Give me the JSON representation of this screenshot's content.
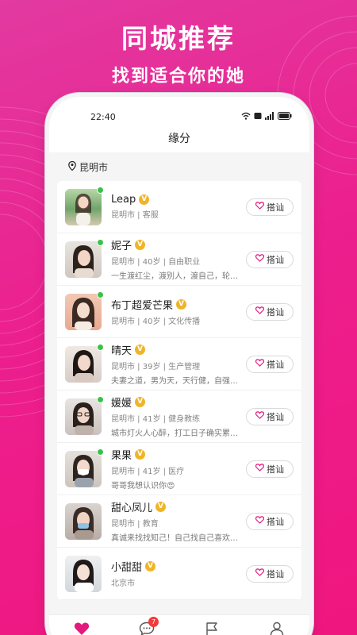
{
  "promo": {
    "headline": "同城推荐",
    "subline": "找到适合你的她"
  },
  "status_bar": {
    "time": "22:40"
  },
  "nav": {
    "title": "缘分"
  },
  "location": {
    "city": "昆明市"
  },
  "users": [
    {
      "name": "Leap",
      "meta": "昆明市 | 客服",
      "bio": "",
      "online": true,
      "greet": "搭讪"
    },
    {
      "name": "妮子",
      "meta": "昆明市 | 40岁 | 自由职业",
      "bio": "一生渡红尘，渡别人，渡自己，轮…",
      "online": true,
      "greet": "搭讪"
    },
    {
      "name": "布丁超爱芒果",
      "meta": "昆明市 | 40岁 | 文化传播",
      "bio": "",
      "online": true,
      "greet": "搭讪"
    },
    {
      "name": "晴天",
      "meta": "昆明市 | 39岁 | 生产管理",
      "bio": "夫妻之道，男为天，天行健，自强…",
      "online": true,
      "greet": "搭讪"
    },
    {
      "name": "媛媛",
      "meta": "昆明市 | 41岁 | 健身教练",
      "bio": "城市灯火人心醉，打工日子确实累…",
      "online": true,
      "greet": "搭讪"
    },
    {
      "name": "果果",
      "meta": "昆明市 | 41岁 | 医疗",
      "bio": "哥哥我想认识你😍",
      "online": true,
      "greet": "搭讪"
    },
    {
      "name": "甜心凤儿",
      "meta": "昆明市 | 教育",
      "bio": "真诚来找找知己！自己找自己喜欢…",
      "online": false,
      "greet": "搭讪"
    },
    {
      "name": "小甜甜",
      "meta": "北京市",
      "bio": "",
      "online": false,
      "greet": "搭讪"
    }
  ],
  "tabs": [
    {
      "label": "缘分",
      "icon": "heart-icon",
      "active": true
    },
    {
      "label": "消息",
      "icon": "chat-icon",
      "badge": "7"
    },
    {
      "label": "任务",
      "icon": "flag-icon"
    },
    {
      "label": "个人",
      "icon": "person-icon"
    }
  ],
  "colors": {
    "brand": "#e3197f",
    "online": "#39c24a",
    "verified": "#f0b428"
  }
}
